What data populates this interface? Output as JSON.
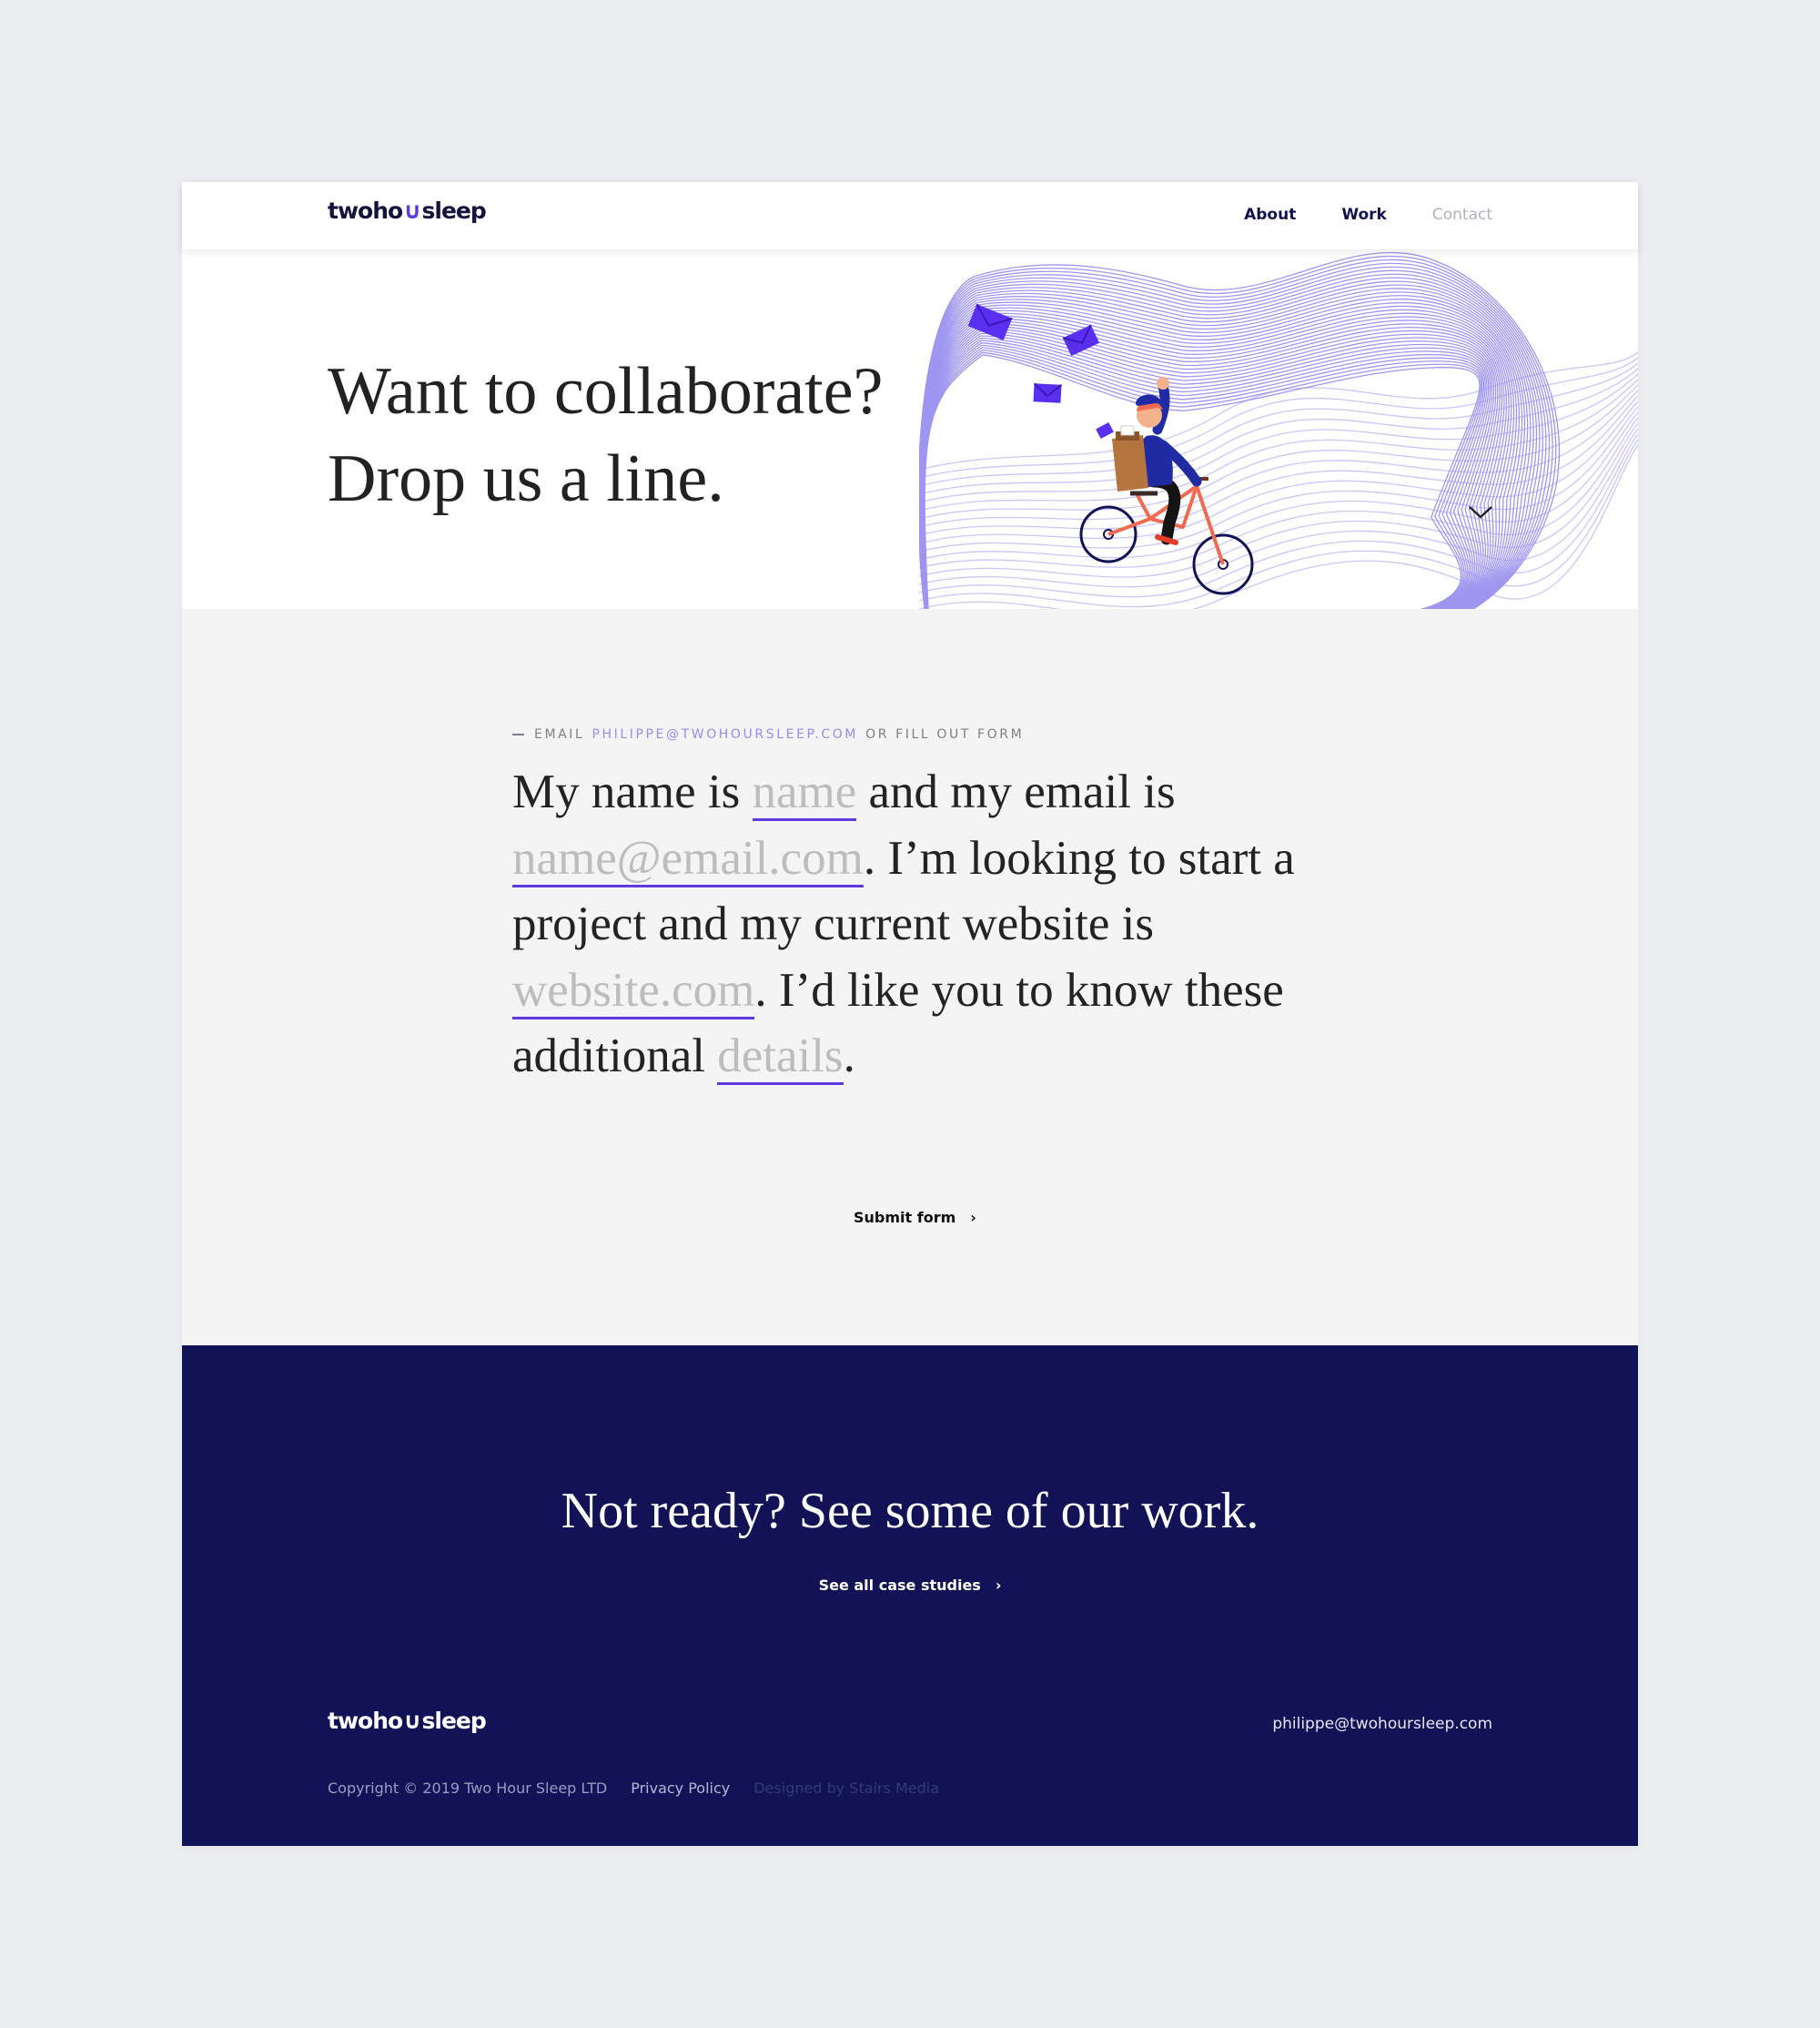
{
  "header": {
    "logo": {
      "part1": "twoho",
      "wave": "∪",
      "part2": "sleep"
    },
    "nav": [
      {
        "label": "About"
      },
      {
        "label": "Work"
      },
      {
        "label": "Contact"
      }
    ]
  },
  "hero": {
    "title_line1": "Want to collaborate?",
    "title_line2": "Drop us a line."
  },
  "form": {
    "lead_prefix": "EMAIL",
    "lead_email": "PHILIPPE@TWOHOURSLEEP.COM",
    "lead_suffix": "OR FILL OUT FORM",
    "text1": "My name is ",
    "name_placeholder": "name",
    "text2": " and my email is ",
    "email_placeholder": "name@email.com",
    "text3": ". I’m looking to start a project and my current website is ",
    "website_placeholder": "website.com",
    "text4": ". I’d like you to know these additional ",
    "details_placeholder": "details",
    "text5": ".",
    "submit_label": "Submit form",
    "submit_arrow": "›"
  },
  "footer": {
    "title": "Not ready? See some of our work.",
    "cases_label": "See all case studies",
    "cases_arrow": "›",
    "logo": {
      "part1": "twoho",
      "wave": "∪",
      "part2": "sleep"
    },
    "email": "philippe@twohoursleep.com",
    "copyright": "Copyright © 2019 Two Hour Sleep LTD",
    "privacy": "Privacy Policy",
    "designed_by": "Designed by Stairs Media"
  },
  "colors": {
    "accent": "#5b3ae0",
    "footer_bg": "#111356",
    "form_bg": "#f4f4f5",
    "page_bg": "#ebedf1"
  },
  "icons": [
    "envelope-icon",
    "chevron-down-icon",
    "arrow-right-icon",
    "cyclist-illustration"
  ]
}
